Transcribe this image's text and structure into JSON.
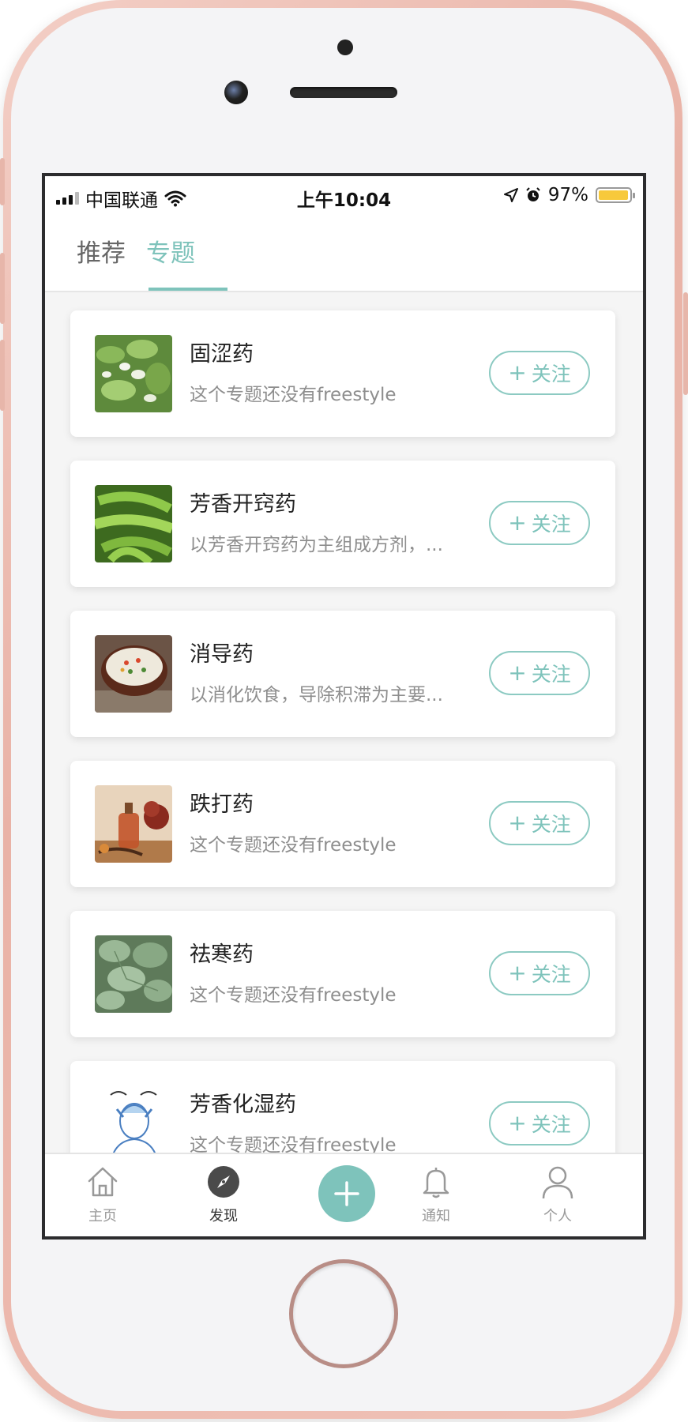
{
  "status_bar": {
    "carrier": "中国联通",
    "time": "上午10:04",
    "battery": "97%",
    "battery_level": 0.97
  },
  "tabs": [
    {
      "label": "推荐",
      "active": false
    },
    {
      "label": "专题",
      "active": true
    }
  ],
  "topics": [
    {
      "title": "固涩药",
      "desc": "这个专题还没有freestyle",
      "thumb": "green-leaves-image"
    },
    {
      "title": "芳香开窍药",
      "desc": "以芳香开窍药为主组成方剂，...",
      "thumb": "green-pods-image"
    },
    {
      "title": "消导药",
      "desc": "以消化饮食，导除积滞为主要...",
      "thumb": "congee-bowl-image"
    },
    {
      "title": "跌打药",
      "desc": "这个专题还没有freestyle",
      "thumb": "oil-bottle-image"
    },
    {
      "title": "祛寒药",
      "desc": "这个专题还没有freestyle",
      "thumb": "herb-leaves-image"
    },
    {
      "title": "芳香化湿药",
      "desc": "这个专题还没有freestyle",
      "thumb": "head-massage-illustration"
    }
  ],
  "follow_label": "关注",
  "bottom_nav": [
    {
      "label": "主页",
      "icon": "home-icon",
      "active": false
    },
    {
      "label": "发现",
      "icon": "compass-icon",
      "active": true
    },
    {
      "label": "",
      "icon": "plus-icon",
      "active": false
    },
    {
      "label": "通知",
      "icon": "bell-icon",
      "active": false
    },
    {
      "label": "个人",
      "icon": "user-icon",
      "active": false
    }
  ],
  "colors": {
    "accent": "#7ec3bb",
    "battery": "#f7c93b",
    "phone_frame": "#e9b2a6"
  }
}
